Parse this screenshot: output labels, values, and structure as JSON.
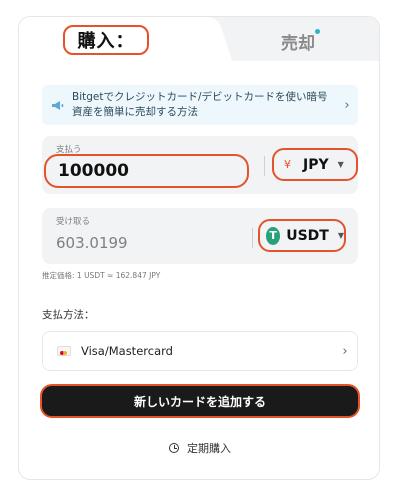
{
  "tabs": {
    "buy_label": "購入：",
    "sell_label": "売却"
  },
  "banner": {
    "text": "Bitgetでクレジットカード/デビットカードを使い暗号資産を簡単に売却する方法",
    "icon": "megaphone-icon"
  },
  "pay": {
    "label": "支払う",
    "amount": "100000",
    "currency_symbol": "¥",
    "currency": "JPY"
  },
  "receive": {
    "label": "受け取る",
    "amount": "603.0199",
    "currency": "USDT",
    "currency_icon_glyph": "T"
  },
  "rate_text": "推定価格: 1 USDT ≈ 162.847 JPY",
  "payment_method": {
    "label": "支払方法：",
    "name": "Visa/Mastercard"
  },
  "cta_label": "新しいカードを追加する",
  "recurring_label": "定期購入",
  "colors": {
    "highlight": "#e4532c",
    "tether": "#26a17b",
    "cta_bg": "#1a1a1a"
  }
}
